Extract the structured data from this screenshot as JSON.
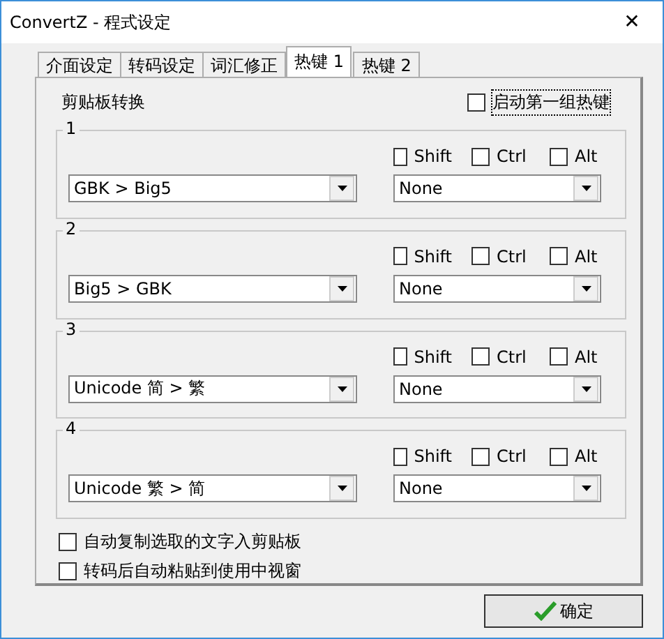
{
  "window": {
    "title": "ConvertZ - 程式设定",
    "close": "✕"
  },
  "tabs": [
    {
      "label": "介面设定",
      "selected": false
    },
    {
      "label": "转码设定",
      "selected": false
    },
    {
      "label": "词汇修正",
      "selected": false
    },
    {
      "label": "热键 1",
      "selected": true
    },
    {
      "label": "热键 2",
      "selected": false
    }
  ],
  "section_label": "剪贴板转换",
  "enable_option": {
    "label": "启动第一组热键",
    "checked": false
  },
  "groups": [
    {
      "title": "1",
      "conversion": "GBK > Big5",
      "modifiers": [
        {
          "label": "Shift",
          "checked": false
        },
        {
          "label": "Ctrl",
          "checked": false
        },
        {
          "label": "Alt",
          "checked": false
        }
      ],
      "key": "None"
    },
    {
      "title": "2",
      "conversion": "Big5 > GBK",
      "modifiers": [
        {
          "label": "Shift",
          "checked": false
        },
        {
          "label": "Ctrl",
          "checked": false
        },
        {
          "label": "Alt",
          "checked": false
        }
      ],
      "key": "None"
    },
    {
      "title": "3",
      "conversion": "Unicode 简 > 繁",
      "modifiers": [
        {
          "label": "Shift",
          "checked": false
        },
        {
          "label": "Ctrl",
          "checked": false
        },
        {
          "label": "Alt",
          "checked": false
        }
      ],
      "key": "None"
    },
    {
      "title": "4",
      "conversion": "Unicode 繁 > 简",
      "modifiers": [
        {
          "label": "Shift",
          "checked": false
        },
        {
          "label": "Ctrl",
          "checked": false
        },
        {
          "label": "Alt",
          "checked": false
        }
      ],
      "key": "None"
    }
  ],
  "options": [
    {
      "label": "自动复制选取的文字入剪贴板",
      "checked": false
    },
    {
      "label": "转码后自动粘贴到使用中视窗",
      "checked": false
    }
  ],
  "ok_button": "确定"
}
